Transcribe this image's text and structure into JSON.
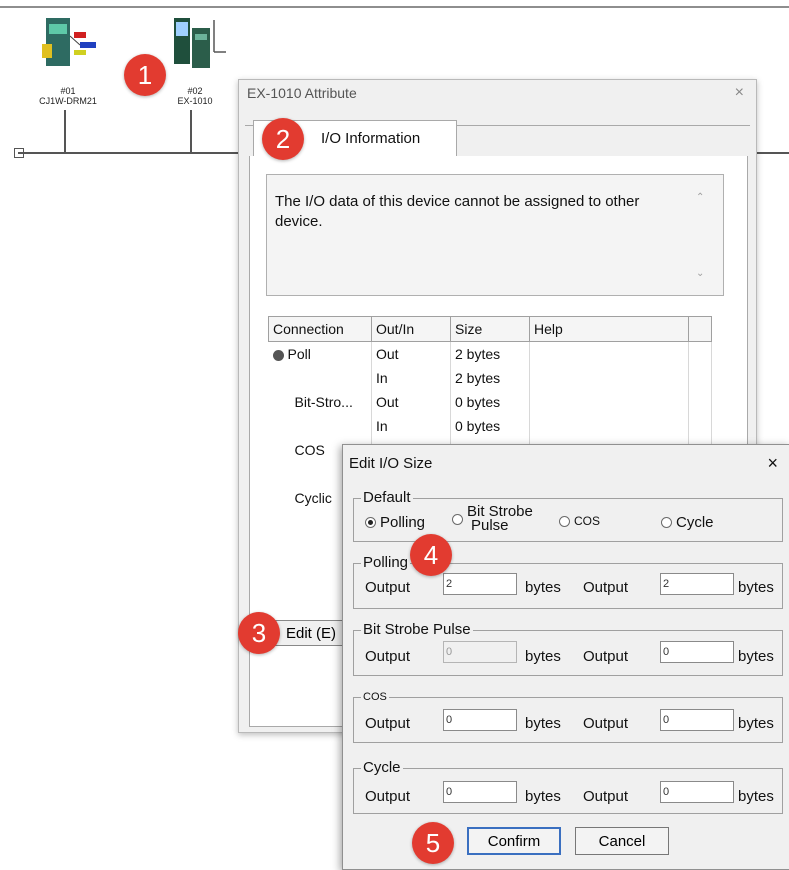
{
  "network": {
    "devices": [
      {
        "number": "#01",
        "name": "CJ1W-DRM21"
      },
      {
        "number": "#02",
        "name": "EX-1010"
      }
    ]
  },
  "attribute_dialog": {
    "title": "EX-1010 Attribute",
    "close": "×",
    "tab_label": "I/O Information",
    "info_text": "The I/O data of this device cannot be assigned to other device.",
    "table": {
      "headers": [
        "Connection",
        "Out/In",
        "Size",
        "Help"
      ],
      "rows": [
        {
          "connection": "Poll",
          "dir": "Out",
          "size": "2 bytes"
        },
        {
          "connection": "",
          "dir": "In",
          "size": "2 bytes"
        },
        {
          "connection": "Bit-Stro...",
          "dir": "Out",
          "size": "0 bytes"
        },
        {
          "connection": "",
          "dir": "In",
          "size": "0 bytes"
        },
        {
          "connection": "COS",
          "dir": "",
          "size": ""
        },
        {
          "connection": "",
          "dir": "",
          "size": ""
        },
        {
          "connection": "Cyclic",
          "dir": "",
          "size": ""
        },
        {
          "connection": "",
          "dir": "",
          "size": ""
        },
        {
          "connection": "",
          "dir": "",
          "size": ""
        },
        {
          "connection": "",
          "dir": "",
          "size": ""
        },
        {
          "connection": "",
          "dir": "",
          "size": ""
        }
      ]
    },
    "edit_button": "Edit (E)"
  },
  "edit_dialog": {
    "title": "Edit I/O Size",
    "close": "×",
    "default_group": {
      "label": "Default",
      "options": [
        "Polling",
        "Bit Strobe Pulse",
        "COS",
        "Cycle"
      ],
      "option_bit_strobe_line1": "Bit Strobe",
      "option_bit_strobe_line2": "Pulse",
      "selected": "Polling"
    },
    "groups": [
      {
        "label": "Polling",
        "out_label": "Output",
        "out_value": "2",
        "unit1": "bytes",
        "in_label": "Output",
        "in_value": "2",
        "unit2": "bytes"
      },
      {
        "label": "Bit Strobe Pulse",
        "out_label": "Output",
        "out_value": "0",
        "unit1": "bytes",
        "in_label": "Output",
        "in_value": "0",
        "unit2": "bytes"
      },
      {
        "label": "COS",
        "out_label": "Output",
        "out_value": "0",
        "unit1": "bytes",
        "in_label": "Output",
        "in_value": "0",
        "unit2": "bytes"
      },
      {
        "label": "Cycle",
        "out_label": "Output",
        "out_value": "0",
        "unit1": "bytes",
        "in_label": "Output",
        "in_value": "0",
        "unit2": "bytes"
      }
    ],
    "confirm_label": "Confirm",
    "cancel_label": "Cancel"
  },
  "callouts": [
    "1",
    "2",
    "3",
    "4",
    "5"
  ],
  "colors": {
    "callout": "#e23b30",
    "focus_border": "#3a6fc0"
  }
}
